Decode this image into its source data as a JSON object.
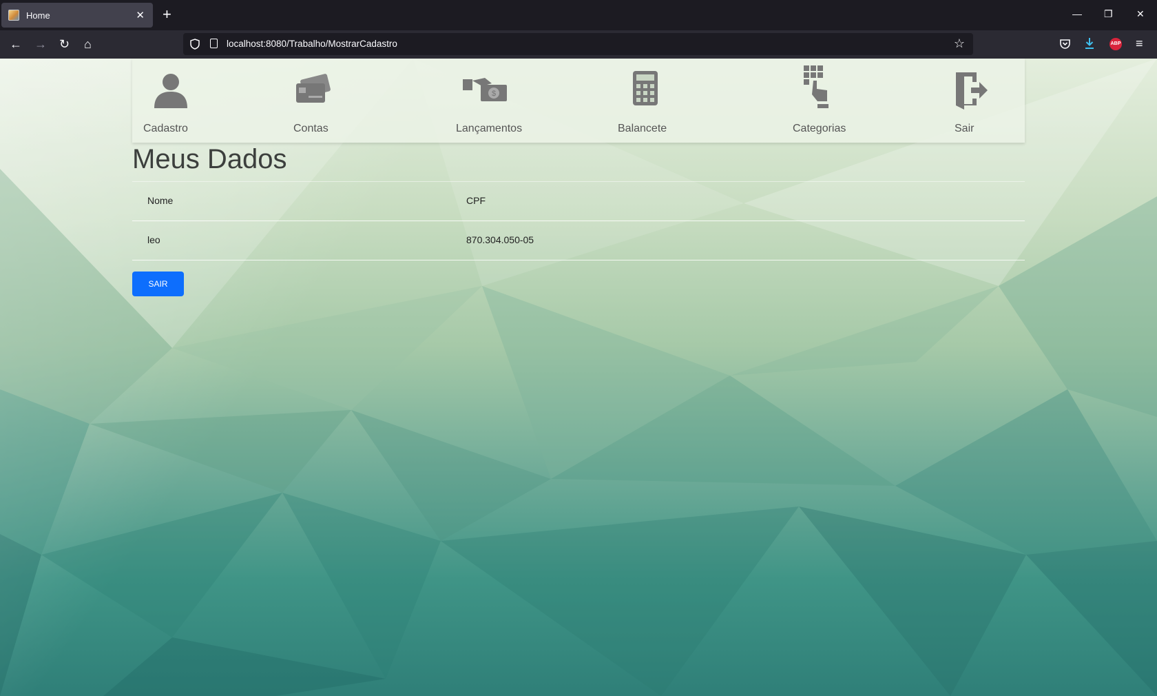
{
  "browser": {
    "tab_title": "Home",
    "tab_close": "✕",
    "new_tab": "+",
    "url": "localhost:8080/Trabalho/MostrarCadastro",
    "abp_label": "ABP"
  },
  "menu": {
    "items": [
      {
        "label": "Cadastro",
        "icon": "user-icon"
      },
      {
        "label": "Contas",
        "icon": "card-icon"
      },
      {
        "label": "Lançamentos",
        "icon": "money-hand-icon"
      },
      {
        "label": "Balancete",
        "icon": "calculator-icon"
      },
      {
        "label": "Categorias",
        "icon": "grid-hand-icon"
      },
      {
        "label": "Sair",
        "icon": "exit-door-icon"
      }
    ]
  },
  "page": {
    "title": "Meus Dados",
    "table": {
      "headers": [
        "Nome",
        "CPF"
      ],
      "rows": [
        [
          "leo",
          "870.304.050-05"
        ]
      ]
    },
    "exit_button": "SAIR"
  },
  "colors": {
    "primary_button": "#0d6efd",
    "icon_gray": "#777777"
  }
}
